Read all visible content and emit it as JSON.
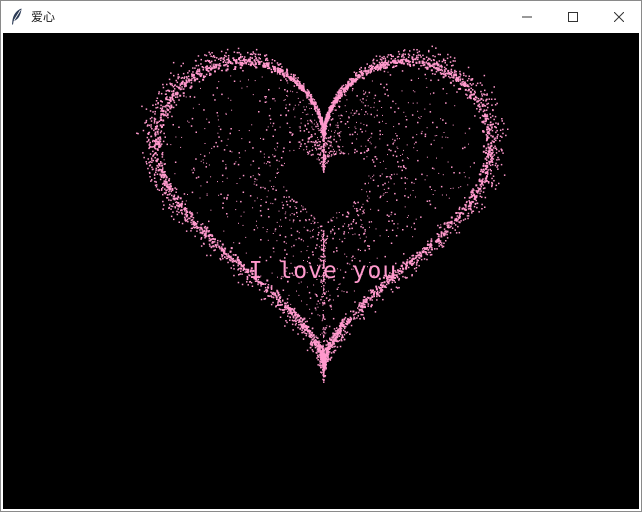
{
  "window": {
    "title": "爱心",
    "icon": "feather-icon"
  },
  "titlebar_buttons": {
    "minimize_icon": "minimize-icon",
    "maximize_icon": "maximize-icon",
    "close_icon": "close-icon"
  },
  "canvas": {
    "background": "#000000",
    "heart_color": "#ff99cc",
    "message": "I love you"
  }
}
